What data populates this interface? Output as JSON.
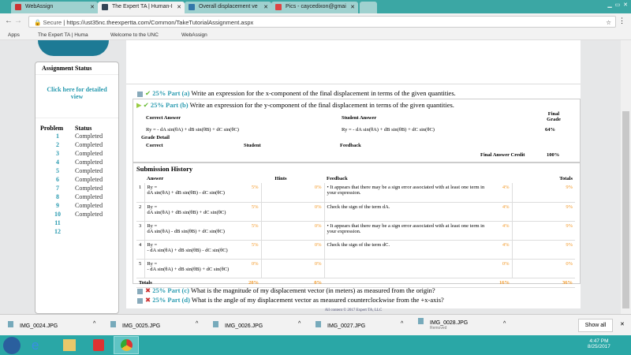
{
  "browser": {
    "tabs": [
      "WebAssign",
      "The Expert TA | Human-I",
      "Overall displacement ve",
      "Pics - caycedixon@gmai"
    ],
    "secure": "Secure",
    "url": "https://ust35nc.theexpertta.com/Common/TakeTutorialAssignment.aspx",
    "bookmarks": [
      "Apps",
      "The Expert TA | Huma",
      "Welcome to the UNC",
      "WebAssign"
    ]
  },
  "sidebar": {
    "title": "Assignment Status",
    "link": "Click here for detailed view",
    "col_problem": "Problem",
    "col_status": "Status",
    "problems": [
      {
        "n": "1",
        "s": "Completed"
      },
      {
        "n": "2",
        "s": "Completed"
      },
      {
        "n": "3",
        "s": "Completed"
      },
      {
        "n": "4",
        "s": "Completed"
      },
      {
        "n": "5",
        "s": "Completed"
      },
      {
        "n": "6",
        "s": "Completed"
      },
      {
        "n": "7",
        "s": "Completed"
      },
      {
        "n": "8",
        "s": "Completed"
      },
      {
        "n": "9",
        "s": "Completed"
      },
      {
        "n": "10",
        "s": "Completed"
      },
      {
        "n": "11",
        "s": ""
      },
      {
        "n": "12",
        "s": ""
      }
    ]
  },
  "parts": {
    "a": {
      "label": "25% Part (a)",
      "text": "Write an expression for the x-component of the final displacement in terms of the given quantities."
    },
    "b": {
      "label": "25% Part (b)",
      "text": "Write an expression for the y-component of the final displacement in terms of the given quantities.",
      "h_correct": "Correct Answer",
      "h_student": "Student Answer",
      "h_grade": "Final Grade",
      "correct": "Ry = - dA sin(θA) + dB sin(θB) + dC sin(θC)",
      "student": "Ry = - dA sin(θA) + dB sin(θB) + dC sin(θC)",
      "grade": "64%",
      "grade_detail": "Grade Detail",
      "gd_correct": "Correct",
      "gd_student": "Student",
      "gd_feedback": "Feedback",
      "fac_label": "Final Answer Credit",
      "fac": "100%"
    },
    "c": {
      "label": "25% Part (c)",
      "text": "What is the magnitude of my displacement vector (in meters) as measured from the origin?"
    },
    "d": {
      "label": "25% Part (d)",
      "text": "What is the angle of my displacement vector as measured counterclockwise from the +x-axis?"
    }
  },
  "history": {
    "title": "Submission History",
    "h_answer": "Answer",
    "h_hints": "Hints",
    "h_feedback": "Feedback",
    "h_totals": "Totals",
    "rows": [
      {
        "n": "1",
        "a1": "Ry =",
        "a2": "dA sin(θA) + dB sin(θB) - dC sin(θC)",
        "p": "5%",
        "h": "0%",
        "f": "•  It appears that there may be a sign error associated with at least one term in your expression.",
        "fp": "4%",
        "t": "9%"
      },
      {
        "n": "2",
        "a1": "Ry =",
        "a2": "dA sin(θA) + dB sin(θB) + dC sin(θC)",
        "p": "5%",
        "h": "0%",
        "f": "Check the sign of the term dA.",
        "fp": "4%",
        "t": "9%"
      },
      {
        "n": "3",
        "a1": "Ry =",
        "a2": "dA sin(θA) - dB sin(θB) + dC sin(θC)",
        "p": "5%",
        "h": "0%",
        "f": "•  It appears that there may be a sign error associated with at least one term in your expression.",
        "fp": "4%",
        "t": "9%"
      },
      {
        "n": "4",
        "a1": "Ry =",
        "a2": "- dA sin(θA) + dB sin(θB) - dC sin(θC)",
        "p": "5%",
        "h": "0%",
        "f": "Check the sign of the term dC.",
        "fp": "4%",
        "t": "9%"
      },
      {
        "n": "5",
        "a1": "Ry =",
        "a2": "- dA sin(θA) + dB sin(θB) + dC sin(θC)",
        "p": "0%",
        "h": "0%",
        "f": "",
        "fp": "0%",
        "t": "0%"
      }
    ],
    "totals_label": "Totals",
    "tot_p": "20%",
    "tot_h": "0%",
    "tot_f": "16%",
    "tot_t": "36%"
  },
  "footer": "All content © 2017 Expert TA, LLC",
  "downloads": [
    {
      "name": "IMG_0024.JPG",
      "sub": ""
    },
    {
      "name": "IMG_0025.JPG",
      "sub": ""
    },
    {
      "name": "IMG_0026.JPG",
      "sub": ""
    },
    {
      "name": "IMG_0027.JPG",
      "sub": ""
    },
    {
      "name": "IMG_0028.JPG",
      "sub": "Removed"
    }
  ],
  "show_all": "Show all",
  "clock": {
    "time": "4:47 PM",
    "date": "8/25/2017"
  }
}
